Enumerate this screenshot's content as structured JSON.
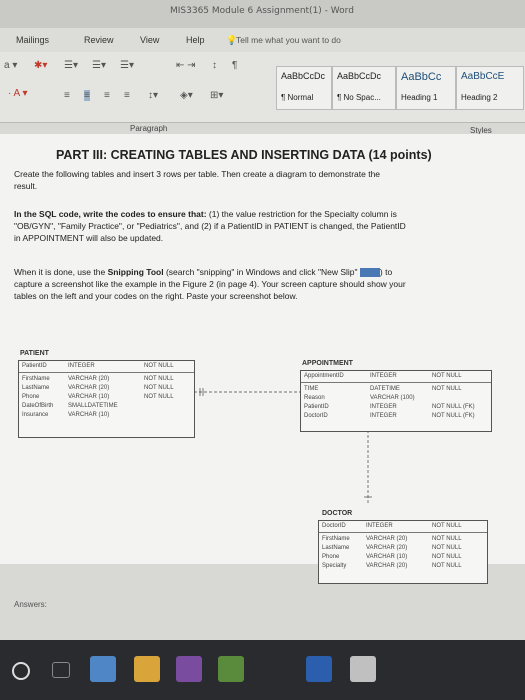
{
  "window": {
    "title": "MIS3365 Module 6 Assignment(1) - Word"
  },
  "tabs": [
    "Mailings",
    "Review",
    "View",
    "Help"
  ],
  "tell_me": "Tell me what you want to do",
  "ribbon": {
    "paragraph_label": "Paragraph",
    "styles_label": "Styles",
    "styles": [
      {
        "sample": "AaBbCcDc",
        "name": "¶ Normal"
      },
      {
        "sample": "AaBbCcDc",
        "name": "¶ No Spac..."
      },
      {
        "sample": "AaBbCc",
        "name": "Heading 1"
      },
      {
        "sample": "AaBbCcE",
        "name": "Heading 2"
      }
    ]
  },
  "doc": {
    "heading": "PART III: CREATING TABLES AND INSERTING DATA (14 points)",
    "p1_l1": "Create the following tables and insert 3 rows per table. Then create a diagram to demonstrate the",
    "p1_l2": "result.",
    "p2_l1_bold": "In the SQL code, write the codes to ensure that:",
    "p2_l1": " (1) the value restriction for the Specialty column is",
    "p2_l2": "\"OB/GYN\", \"Family Practice\", or \"Pediatrics\", and (2) if a PatientID in PATIENT is changed, the PatientID",
    "p2_l3": "in APPOINTMENT will also be updated.",
    "p3_l1a": "When it is done, use the ",
    "p3_l1_bold": "Snipping Tool",
    "p3_l1b": " (search \"snipping\" in Windows and click \"New Slip\"",
    "p3_l1c": ") to",
    "p3_l2": "capture a screenshot like the example in the Figure 2 (in page 4). Your screen capture should show your",
    "p3_l3": "tables on the left and your codes on the right. Paste your screenshot below.",
    "answers": "Answers:"
  },
  "diagram": {
    "patient": {
      "title": "PATIENT",
      "rows": [
        [
          "PatientID",
          "INTEGER",
          "NOT NULL"
        ],
        [
          "FirstName",
          "VARCHAR (20)",
          "NOT NULL"
        ],
        [
          "LastName",
          "VARCHAR (20)",
          "NOT NULL"
        ],
        [
          "Phone",
          "VARCHAR (10)",
          "NOT NULL"
        ],
        [
          "DateOfBirth",
          "SMALLDATETIME",
          ""
        ],
        [
          "Insurance",
          "VARCHAR (10)",
          ""
        ]
      ]
    },
    "appointment": {
      "title": "APPOINTMENT",
      "rows": [
        [
          "AppointmentID",
          "INTEGER",
          "NOT NULL"
        ],
        [
          "TIME",
          "DATETIME",
          "NOT NULL"
        ],
        [
          "Reason",
          "VARCHAR (100)",
          ""
        ],
        [
          "PatientID",
          "INTEGER",
          "NOT NULL (FK)"
        ],
        [
          "DoctorID",
          "INTEGER",
          "NOT NULL (FK)"
        ]
      ]
    },
    "doctor": {
      "title": "DOCTOR",
      "rows": [
        [
          "DoctorID",
          "INTEGER",
          "NOT NULL"
        ],
        [
          "FirstName",
          "VARCHAR (20)",
          "NOT NULL"
        ],
        [
          "LastName",
          "VARCHAR (20)",
          "NOT NULL"
        ],
        [
          "Phone",
          "VARCHAR (10)",
          "NOT NULL"
        ],
        [
          "Specialty",
          "VARCHAR (20)",
          "NOT NULL"
        ]
      ]
    }
  },
  "colors": {
    "page": "#f3f3f1",
    "ribbon": "#e4e4e1",
    "taskbar": "#2a2b2e"
  }
}
